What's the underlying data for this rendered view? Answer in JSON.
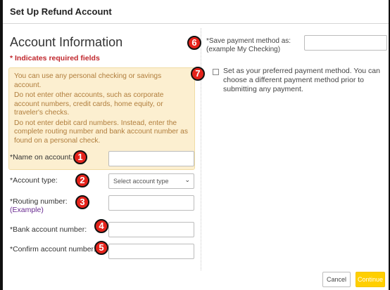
{
  "dialog": {
    "title": "Set Up Refund Account"
  },
  "section": {
    "title": "Account Information",
    "required_note": "* Indicates required fields"
  },
  "info_box": {
    "lines": [
      "You can use any personal checking or savings account.",
      "Do not enter other accounts, such as corporate account numbers, credit cards, home equity, or traveler's checks.",
      "Do not enter debit card numbers. Instead, enter the complete routing number and bank account number as found on a personal check."
    ]
  },
  "fields": {
    "name_on_account": {
      "label": "*Name on account:",
      "value": ""
    },
    "account_type": {
      "label": "*Account type:",
      "selected": "Select account type"
    },
    "routing_number": {
      "label": "*Routing number:",
      "link": "(Example)",
      "value": ""
    },
    "bank_account_number": {
      "label": "*Bank account number:",
      "value": ""
    },
    "confirm_account_number": {
      "label": "*Confirm account number:",
      "value": ""
    }
  },
  "save_method": {
    "label_line1": "*Save payment method as:",
    "label_line2": "(example My Checking)",
    "value": ""
  },
  "preferred": {
    "checked": false,
    "text": "Set as your preferred payment method. You can choose a different payment method prior to submitting any payment."
  },
  "badges": [
    "1",
    "2",
    "3",
    "4",
    "5",
    "6",
    "7"
  ],
  "buttons": {
    "cancel": "Cancel",
    "continue": "Continue"
  },
  "colors": {
    "required_red": "#c0272d",
    "info_bg": "#fcefd0",
    "info_text": "#b07d3c",
    "link_purple": "#6a2c91",
    "badge_red": "#e5231b",
    "continue_yellow": "#ffcf00"
  }
}
